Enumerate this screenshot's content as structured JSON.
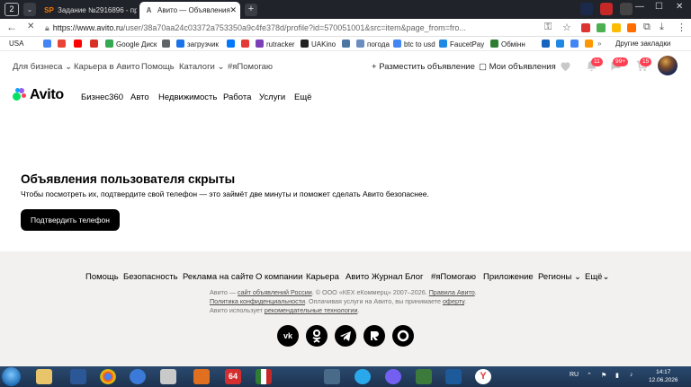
{
  "browser": {
    "tab_count": "2",
    "tabs": [
      {
        "label": "Задание №2916896 - про",
        "favicon": "SP"
      },
      {
        "label": "Авито — Объявления",
        "favicon": "A"
      }
    ],
    "url_domain": "https://www.avito.ru",
    "url_path": "/user/38a70aa24c03372a753350a9c4fe378d/profile?id=570051001&src=item&page_from=fro...",
    "bookmarks": [
      {
        "label": "USA",
        "color": "#2b5bd6"
      },
      {
        "label": "",
        "color": "#4285f4"
      },
      {
        "label": "",
        "color": "#ea4335"
      },
      {
        "label": "",
        "color": "#ff0000"
      },
      {
        "label": "",
        "color": "#d93025"
      },
      {
        "label": "Google Диск",
        "color": "#34a853"
      },
      {
        "label": "",
        "color": "#5f6368"
      },
      {
        "label": "загрузчик",
        "color": "#1a73e8"
      },
      {
        "label": "",
        "color": "#0077ff"
      },
      {
        "label": "",
        "color": "#e53935"
      },
      {
        "label": "rutracker",
        "color": "#7b3fb8"
      },
      {
        "label": "UAKino",
        "color": "#222222"
      },
      {
        "label": "",
        "color": "#4c75a3"
      },
      {
        "label": "погода",
        "color": "#6c8ebf"
      },
      {
        "label": "btc to usd",
        "color": "#4285f4"
      },
      {
        "label": "FaucetPay",
        "color": "#1e88e5"
      },
      {
        "label": "Обмінн",
        "color": "#2e7d32"
      }
    ],
    "other_bookmarks": "Другие закладки"
  },
  "avito": {
    "topnav": {
      "business": "Для бизнеса",
      "career": "Карьера в Авито",
      "help": "Помощь",
      "catalogs": "Каталоги",
      "hashtag": "#яПомогаю",
      "post_ad": "Разместить объявление",
      "my_ads": "Мои объявления",
      "badges": {
        "notifications": "11",
        "messages": "99+",
        "cart": "15"
      }
    },
    "logo": "Avito",
    "mainnav": [
      "Бизнес360",
      "Авто",
      "Недвижимость",
      "Работа",
      "Услуги",
      "Ещё"
    ],
    "content": {
      "title": "Объявления пользователя скрыты",
      "description": "Чтобы посмотреть их, подтвердите свой телефон — это займёт две минуты и поможет сделать Авито безопаснее.",
      "button": "Подтвердить телефон"
    },
    "footer": {
      "links": [
        "Помощь",
        "Безопасность",
        "Реклама на сайте",
        "О компании",
        "Карьера",
        "Авито Журнал",
        "Блог",
        "#яПомогаю",
        "Приложение",
        "Регионы",
        "Ещё"
      ],
      "legal": {
        "prefix": "Авито — ",
        "site_link": "сайт объявлений России",
        "copyright": ". © ООО «КЕХ еКоммерц» 2007–2026. ",
        "rules": "Правила Авито",
        "privacy": "Политика конфиденциальности",
        "paid": ". Оплачивая услуги на Авито, вы принимаете ",
        "offer": "оферту",
        "uses": "Авито использует ",
        "rec": "рекомендательные технологии"
      },
      "social": [
        "vk",
        "ok",
        "telegram",
        "rutube",
        "dzen"
      ]
    }
  },
  "taskbar": {
    "lang": "RU",
    "time": "14:17",
    "date": "12.06.2026"
  },
  "colors": {
    "avito_dot_green": "#04e061",
    "avito_dot_blue": "#0aa5ff",
    "avito_dot_red": "#ff4053",
    "avito_dot_purple": "#965eeb",
    "badge": "#ff4053",
    "footer_bg": "#f2f1f0"
  }
}
